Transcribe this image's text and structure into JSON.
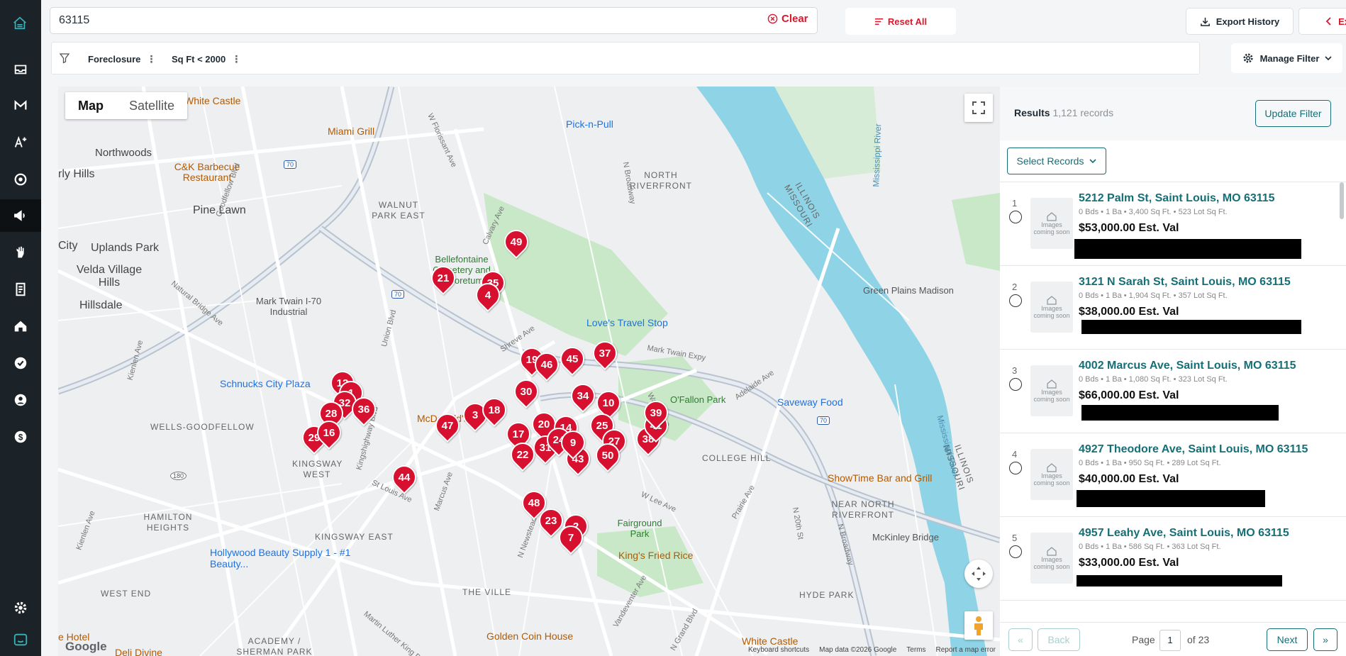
{
  "search": {
    "value": "63115",
    "clear_label": "Clear"
  },
  "toolbar": {
    "reset_label": "Reset All",
    "export_label": "Export History",
    "exit_label": "Exit"
  },
  "filters": {
    "chips": [
      "Foreclosure",
      "Sq Ft < 2000"
    ],
    "manage_label": "Manage Filter"
  },
  "map": {
    "tabs": [
      "Map",
      "Satellite"
    ],
    "pins": [
      "49",
      "21",
      "35",
      "4",
      "19",
      "46",
      "45",
      "37",
      "12",
      "1",
      "32",
      "36",
      "28",
      "29",
      "16",
      "30",
      "34",
      "10",
      "3",
      "18",
      "47",
      "20",
      "14",
      "17",
      "31",
      "22",
      "43",
      "25",
      "27",
      "50",
      "38",
      "41",
      "39",
      "44",
      "48",
      "23",
      "2",
      "7",
      "24",
      "9"
    ],
    "places": [
      "Northwoods",
      "Pine Lawn",
      "Uplands Park",
      "Velda Village Hills",
      "Hillsdale",
      "Walnut Park East",
      "North Riverfront",
      "Mark Twain I-70 Industrial",
      "Wells-Goodfellow",
      "Kingsway West",
      "Hamilton Heights",
      "Kingsway East",
      "West End",
      "The Ville",
      "Academy / Sherman Park",
      "College Hill",
      "Near North Riverfront",
      "Hyde Park",
      "Fairground Park",
      "O'Fallon Park",
      "Bellefontaine Cemetery and Arboretum",
      "Green Plains Madison",
      "Illinois Missouri",
      "Illinois Missouri",
      "Mississippi River",
      "Mississippi River",
      "rly Hills",
      "City"
    ],
    "pois": [
      "White Castle",
      "Miami Grill",
      "C&K Barbecue Restaurant",
      "Pick-n-Pull",
      "Love's Travel Stop",
      "Schnucks City Plaza",
      "McDonald's",
      "Saveway Food",
      "ShowTime Bar and Grill",
      "King's Fried Rice",
      "Hollywood Beauty Supply 1 - #1 Beauty...",
      "Golden Coin House",
      "White Castle",
      "McKinley Bridge",
      "Deli Divine",
      "e Hotel"
    ],
    "streets": [
      "W Florissant Ave",
      "Goodfellow Blvd",
      "Natural Bridge Ave",
      "Union Blvd",
      "Kingshighway Blvd",
      "N Broadway",
      "Shreve Ave",
      "Mark Twain Expy",
      "Adelaide Ave",
      "N Newstead Ave",
      "Marcus Ave",
      "Kienlen Ave",
      "Martin Luther King Dr",
      "N Grand Blvd",
      "Vandeventer Ave",
      "St Louis Ave",
      "W Lee Ave",
      "Calvary Ave",
      "Prairie Ave",
      "Warne Ave",
      "N 20th St",
      "N Broadway",
      "Kienlen Ave"
    ],
    "footer": [
      "Keyboard shortcuts",
      "Map data ©2026 Google",
      "Terms",
      "Report a map error"
    ],
    "google": "Google",
    "shields": [
      "70",
      "70",
      "70",
      "180"
    ]
  },
  "results": {
    "title": "Results",
    "count": "1,121 records",
    "update_label": "Update Filter",
    "select_label": "Select Records",
    "thumb_text": "Images coming soon",
    "records": [
      {
        "num": "1",
        "address": "5212 Palm St, Saint Louis, MO 63115",
        "meta": "0 Bds • 1 Ba • 3,400 Sq Ft. • 523 Lot Sq Ft.",
        "price": "$53,000.00 Est. Val"
      },
      {
        "num": "2",
        "address": "3121 N Sarah St, Saint Louis, MO 63115",
        "meta": "0 Bds • 1 Ba • 1,904 Sq Ft. • 357 Lot Sq Ft.",
        "price": "$38,000.00 Est. Val"
      },
      {
        "num": "3",
        "address": "4002 Marcus Ave, Saint Louis, MO 63115",
        "meta": "0 Bds • 1 Ba • 1,080 Sq Ft. • 323 Lot Sq Ft.",
        "price": "$66,000.00 Est. Val"
      },
      {
        "num": "4",
        "address": "4927 Theodore Ave, Saint Louis, MO 63115",
        "meta": "0 Bds • 1 Ba • 950 Sq Ft. • 289 Lot Sq Ft.",
        "price": "$40,000.00 Est. Val"
      },
      {
        "num": "5",
        "address": "4957 Leahy Ave, Saint Louis, MO 63115",
        "meta": "0 Bds • 1 Ba • 586 Sq Ft. • 363 Lot Sq Ft.",
        "price": "$33,000.00 Est. Val"
      }
    ]
  },
  "pager": {
    "first": "«",
    "back": "Back",
    "page_label": "Page",
    "page": "1",
    "of": "of 23",
    "next": "Next",
    "last": "»"
  },
  "colors": {
    "brand": "#156f76",
    "danger": "#d8182c",
    "pin": "#d81030",
    "sidebar": "#1c2328"
  }
}
